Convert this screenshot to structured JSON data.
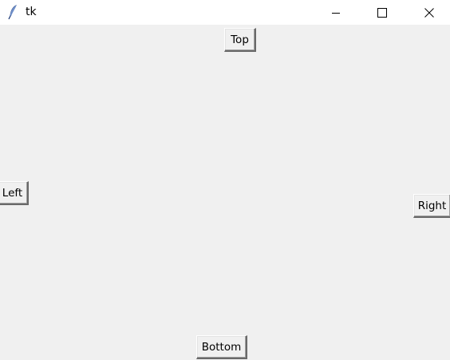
{
  "window": {
    "title": "tk",
    "controls": {
      "minimize": "minimize-icon",
      "maximize": "maximize-icon",
      "close": "close-icon"
    }
  },
  "buttons": {
    "top": "Top",
    "left": "Left",
    "right": "Right",
    "bottom": "Bottom"
  },
  "colors": {
    "background": "#f0f0f0",
    "titlebar": "#ffffff",
    "text": "#000000"
  }
}
